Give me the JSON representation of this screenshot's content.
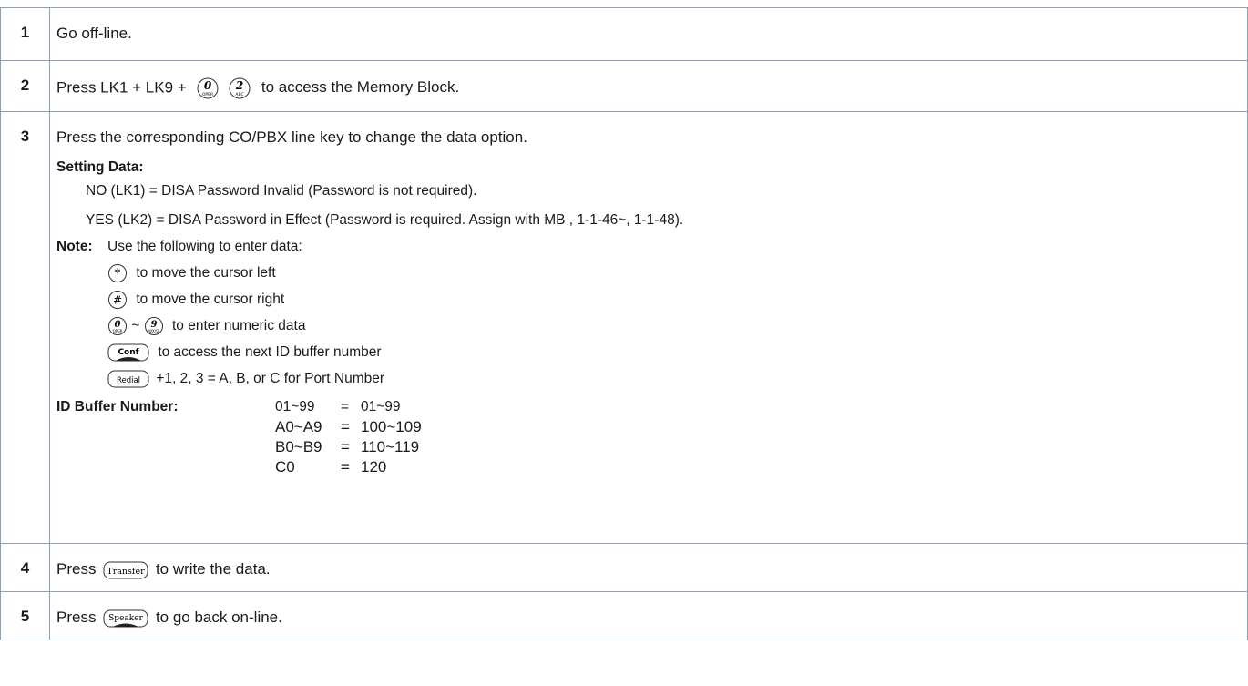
{
  "steps": [
    {
      "num": "1",
      "text": "Go off-line."
    },
    {
      "num": "2",
      "pre": "Press LK1 + LK9 +",
      "post": "to access the Memory Block.",
      "keys": [
        {
          "digit": "0",
          "sub": "OPER"
        },
        {
          "digit": "2",
          "sub": "ABC"
        }
      ]
    },
    {
      "num": "3",
      "text": "Press the corresponding CO/PBX line key to change the data option.",
      "setting_title": "Setting Data:",
      "setting_lines": [
        "NO (LK1) = DISA Password Invalid (Password is not required).",
        "YES (LK2) = DISA Password in Effect (Password is required. Assign with MB , 1-1-46~, 1-1-48)."
      ],
      "note_label": "Note:",
      "note_intro": "Use the following to enter data:",
      "note_items": [
        {
          "key": "star-key",
          "glyph": "*",
          "text": "to move the cursor left"
        },
        {
          "key": "pound-key",
          "glyph": "#",
          "text": "to move the cursor right"
        },
        {
          "key": "digit-range",
          "range_from": {
            "digit": "0",
            "sub": "OPER"
          },
          "range_sep": "~",
          "range_to": {
            "digit": "9",
            "sub": "WXYZ"
          },
          "text": "to enter numeric data"
        },
        {
          "key": "conf-key",
          "glyph": "Conf",
          "text": "to access the next ID buffer number"
        },
        {
          "key": "redial-key",
          "glyph": "Redial",
          "text": "+1, 2, 3 = A, B, or C for Port Number"
        }
      ],
      "id_label": "ID Buffer Number:",
      "id_rows": [
        {
          "a": "01~99",
          "eq": "=",
          "b": "01~99"
        },
        {
          "a": "A0~A9",
          "eq": "=",
          "b": "100~109"
        },
        {
          "a": "B0~B9",
          "eq": "=",
          "b": "110~119"
        },
        {
          "a": "C0",
          "eq": "=",
          "b": "120"
        }
      ]
    },
    {
      "num": "4",
      "pre": "Press",
      "key": "Transfer",
      "post": "to write the data."
    },
    {
      "num": "5",
      "pre": "Press",
      "key": "Speaker",
      "post": "to go back on-line."
    }
  ]
}
